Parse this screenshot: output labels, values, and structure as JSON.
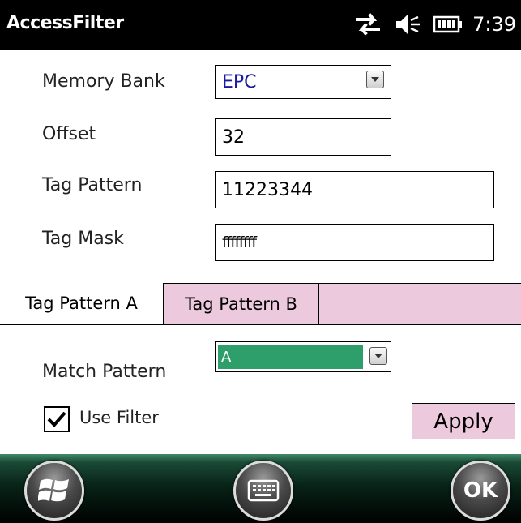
{
  "titlebar": {
    "title": "AccessFilter",
    "time": "7:39",
    "icons": [
      "connectivity-icon",
      "volume-muted-icon",
      "battery-icon"
    ]
  },
  "form": {
    "memory_bank_label": "Memory Bank",
    "memory_bank_value": "EPC",
    "offset_label": "Offset",
    "offset_value": "32",
    "tag_pattern_label": "Tag Pattern",
    "tag_pattern_value": "11223344",
    "tag_mask_label": "Tag Mask",
    "tag_mask_value": "ffffffff"
  },
  "tabs": [
    {
      "label": "Tag Pattern A",
      "selected": true
    },
    {
      "label": "Tag Pattern B",
      "selected": false
    }
  ],
  "pattern": {
    "match_label": "Match Pattern",
    "match_value": "A",
    "use_filter_label": "Use Filter",
    "use_filter_checked": true,
    "apply_label": "Apply"
  },
  "softkeys": {
    "start_icon": "windows-start-icon",
    "keyboard_icon": "keyboard-icon",
    "ok_label": "OK"
  },
  "colors": {
    "tab_inactive": "#ecc9dd",
    "match_highlight": "#2e9e6b",
    "memory_bank_text": "#1a1aa0"
  }
}
